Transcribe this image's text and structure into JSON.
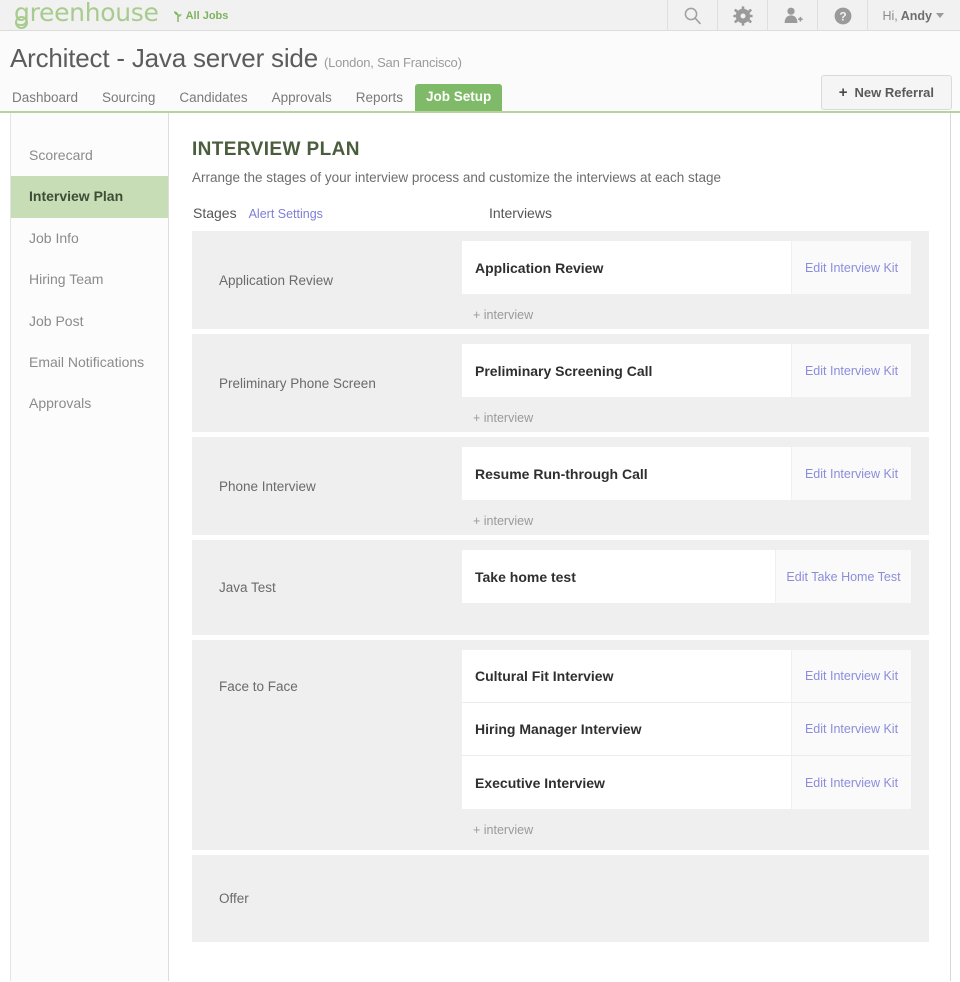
{
  "brand": {
    "logo_text": "greenhouse",
    "all_jobs_label": "All Jobs",
    "sprout_icon": "sprout-icon"
  },
  "header_icons": [
    {
      "name": "search-icon",
      "label": "Search"
    },
    {
      "name": "gear-icon",
      "label": "Settings"
    },
    {
      "name": "add-user-icon",
      "label": "Add User"
    },
    {
      "name": "help-icon",
      "label": "Help"
    }
  ],
  "account": {
    "greeting_prefix": "Hi,",
    "user_name": "Andy",
    "caret_icon": "chevron-down-icon"
  },
  "job": {
    "title": "Architect - Java server side",
    "locations": "(London, San Francisco)"
  },
  "tabs": [
    {
      "label": "Dashboard",
      "active": false
    },
    {
      "label": "Sourcing",
      "active": false
    },
    {
      "label": "Candidates",
      "active": false
    },
    {
      "label": "Approvals",
      "active": false
    },
    {
      "label": "Reports",
      "active": false
    },
    {
      "label": "Job Setup",
      "active": true
    }
  ],
  "new_referral": {
    "plus": "+",
    "label": "New Referral"
  },
  "sidebar": {
    "items": [
      {
        "label": "Scorecard",
        "active": false
      },
      {
        "label": "Interview Plan",
        "active": true
      },
      {
        "label": "Job Info",
        "active": false
      },
      {
        "label": "Hiring Team",
        "active": false
      },
      {
        "label": "Job Post",
        "active": false
      },
      {
        "label": "Email Notifications",
        "active": false
      },
      {
        "label": "Approvals",
        "active": false
      }
    ]
  },
  "main": {
    "page_title": "INTERVIEW PLAN",
    "subtitle": "Arrange the stages of your interview process and customize the interviews at each stage",
    "columns": {
      "stages": "Stages",
      "alert_settings": "Alert Settings",
      "interviews": "Interviews"
    },
    "add_interview_label": "+ interview",
    "stages": [
      {
        "name": "Application Review",
        "interviews": [
          {
            "name": "Application Review",
            "edit_label": "Edit Interview Kit"
          }
        ],
        "show_add": true
      },
      {
        "name": "Preliminary Phone Screen",
        "interviews": [
          {
            "name": "Preliminary Screening Call",
            "edit_label": "Edit Interview Kit"
          }
        ],
        "show_add": true
      },
      {
        "name": "Phone Interview",
        "interviews": [
          {
            "name": "Resume Run-through Call",
            "edit_label": "Edit Interview Kit"
          }
        ],
        "show_add": true
      },
      {
        "name": "Java Test",
        "interviews": [
          {
            "name": "Take home test",
            "edit_label": "Edit Take Home Test"
          }
        ],
        "show_add": false
      },
      {
        "name": "Face to Face",
        "interviews": [
          {
            "name": "Cultural Fit Interview",
            "edit_label": "Edit Interview Kit"
          },
          {
            "name": "Hiring Manager Interview",
            "edit_label": "Edit Interview Kit"
          },
          {
            "name": "Executive Interview",
            "edit_label": "Edit Interview Kit"
          }
        ],
        "show_add": true
      },
      {
        "name": "Offer",
        "interviews": [],
        "show_add": false
      }
    ]
  },
  "colors": {
    "brand_green": "#7fba68",
    "logo_green": "#a8cb8e",
    "active_sidebar": "#c6ddb6",
    "link_purple": "#8b8ddb",
    "header_rule": "#b4d49a"
  }
}
